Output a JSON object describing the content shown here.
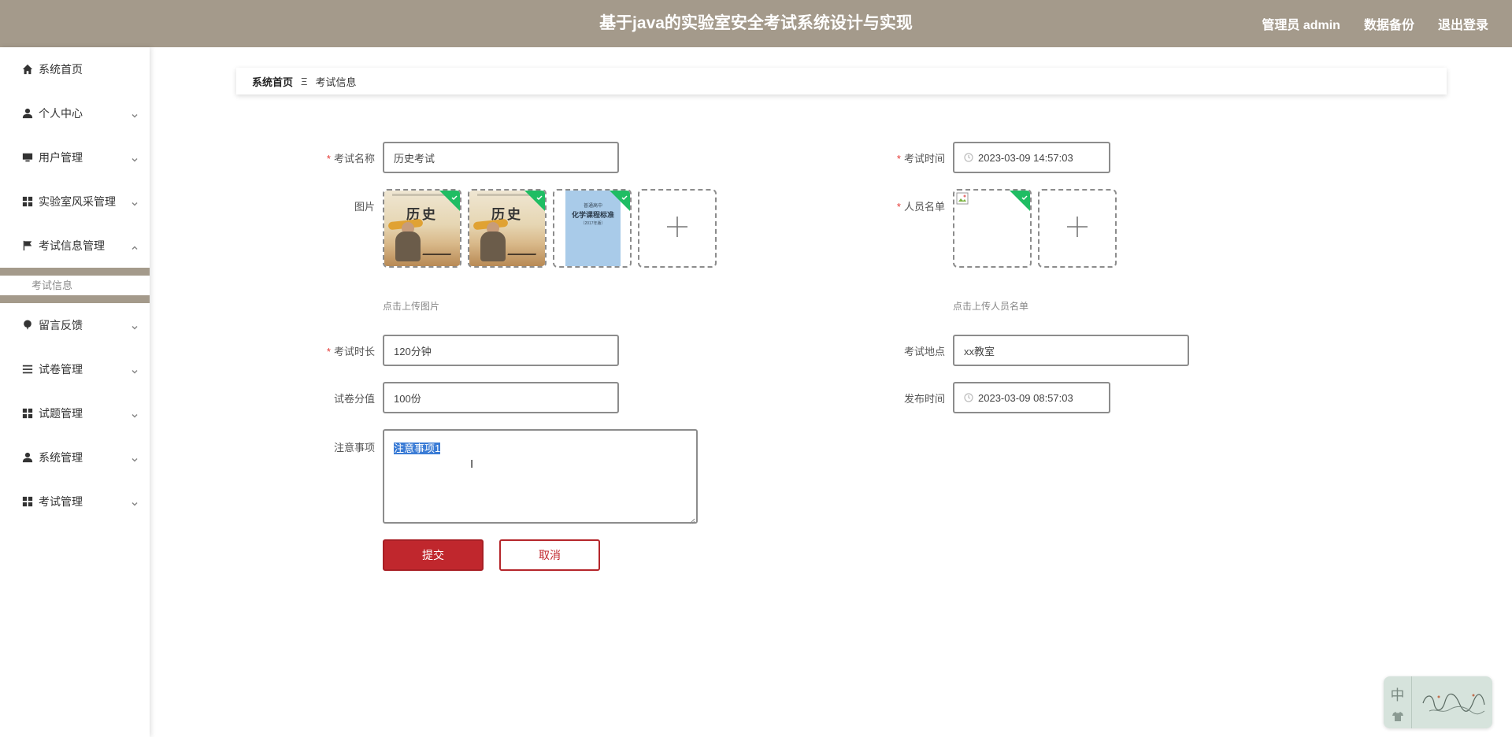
{
  "header": {
    "title": "基于java的实验室安全考试系统设计与实现",
    "nav": [
      "管理员 admin",
      "数据备份",
      "退出登录"
    ]
  },
  "sidebar": {
    "items": [
      {
        "label": "系统首页",
        "icon": "home-icon",
        "expandable": false
      },
      {
        "label": "个人中心",
        "icon": "user-icon",
        "expandable": true
      },
      {
        "label": "用户管理",
        "icon": "monitor-icon",
        "expandable": true
      },
      {
        "label": "实验室风采管理",
        "icon": "grid-icon",
        "expandable": true
      },
      {
        "label": "考试信息管理",
        "icon": "flag-icon",
        "expandable": true,
        "expanded": true,
        "children": [
          "考试信息"
        ]
      },
      {
        "label": "留言反馈",
        "icon": "balloon-icon",
        "expandable": true
      },
      {
        "label": "试卷管理",
        "icon": "list-icon",
        "expandable": true
      },
      {
        "label": "试题管理",
        "icon": "grid-icon",
        "expandable": true
      },
      {
        "label": "系统管理",
        "icon": "user-icon",
        "expandable": true
      },
      {
        "label": "考试管理",
        "icon": "grid-icon",
        "expandable": true
      }
    ]
  },
  "breadcrumb": {
    "home": "系统首页",
    "separator": "Ξ",
    "current": "考试信息"
  },
  "form": {
    "exam_name": {
      "label": "考试名称",
      "required": true,
      "value": "历史考试"
    },
    "exam_time": {
      "label": "考试时间",
      "required": true,
      "value": "2023-03-09 14:57:03"
    },
    "image": {
      "label": "图片",
      "required": false,
      "hint": "点击上传图片",
      "items": [
        {
          "title": "历史",
          "kind": "book-history"
        },
        {
          "title": "历史",
          "kind": "book-history"
        },
        {
          "title": "化学课程标准",
          "kind": "book-blue",
          "top": "普通高中",
          "bottom": "（2017年版）"
        }
      ]
    },
    "roster": {
      "label": "人员名单",
      "required": true,
      "hint": "点击上传人员名单"
    },
    "duration": {
      "label": "考试时长",
      "required": true,
      "value": "120分钟"
    },
    "location": {
      "label": "考试地点",
      "required": false,
      "value": "xx教室"
    },
    "score": {
      "label": "试卷分值",
      "required": false,
      "value": "100份"
    },
    "publish_time": {
      "label": "发布时间",
      "required": false,
      "value": "2023-03-09 08:57:03"
    },
    "notes": {
      "label": "注意事项",
      "required": false,
      "value": "注意事项1"
    },
    "submit": "提交",
    "cancel": "取消"
  },
  "widget": {
    "lang": "中"
  },
  "colors": {
    "header": "#a49a8b",
    "primary": "#c0272d",
    "success_corner": "#1fbd63",
    "selection": "#3a7bd5"
  }
}
